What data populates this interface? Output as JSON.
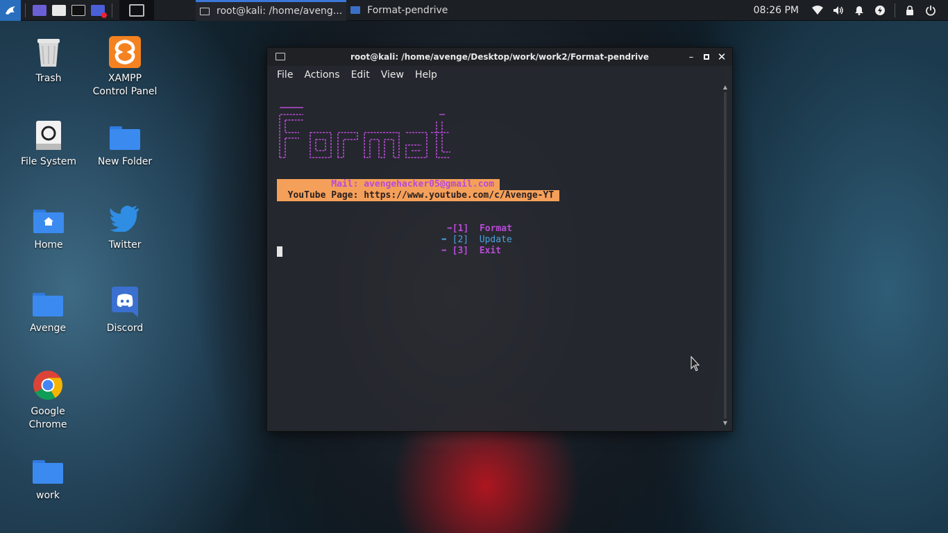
{
  "taskbar": {
    "tasks": [
      {
        "label": "root@kali: /home/aveng..."
      },
      {
        "label": "Format-pendrive"
      }
    ],
    "clock": "08:26 PM"
  },
  "desktop": {
    "icons": [
      {
        "label": "Trash"
      },
      {
        "label": "XAMPP\nControl Panel"
      },
      {
        "label": "File System"
      },
      {
        "label": "New Folder"
      },
      {
        "label": "Home"
      },
      {
        "label": "Twitter"
      },
      {
        "label": "Avenge"
      },
      {
        "label": "Discord"
      },
      {
        "label": "Google\nChrome"
      },
      {
        "label": "work"
      }
    ]
  },
  "window": {
    "title": "root@kali: /home/avenge/Desktop/work/work2/Format-pendrive",
    "menu": [
      "File",
      "Actions",
      "Edit",
      "View",
      "Help"
    ],
    "terminal": {
      "mail_line": "          Mail: avengehacker05@gmail.com",
      "youtube_line": "  YouTube Page: https://www.youtube.com/c/Avenge-YT",
      "options": [
        {
          "arrow": "➡",
          "key": "[1]",
          "label": "Format"
        },
        {
          "arrow": "➡",
          "key": "[2]",
          "label": "Update"
        },
        {
          "arrow": "➡",
          "key": "[3]",
          "label": "Exit"
        }
      ]
    }
  },
  "colors": {
    "accent": "#2a6fbd",
    "banner_purple": "#b84bd6",
    "highlight_orange": "#f5a05a",
    "update_blue": "#4aa3df"
  }
}
